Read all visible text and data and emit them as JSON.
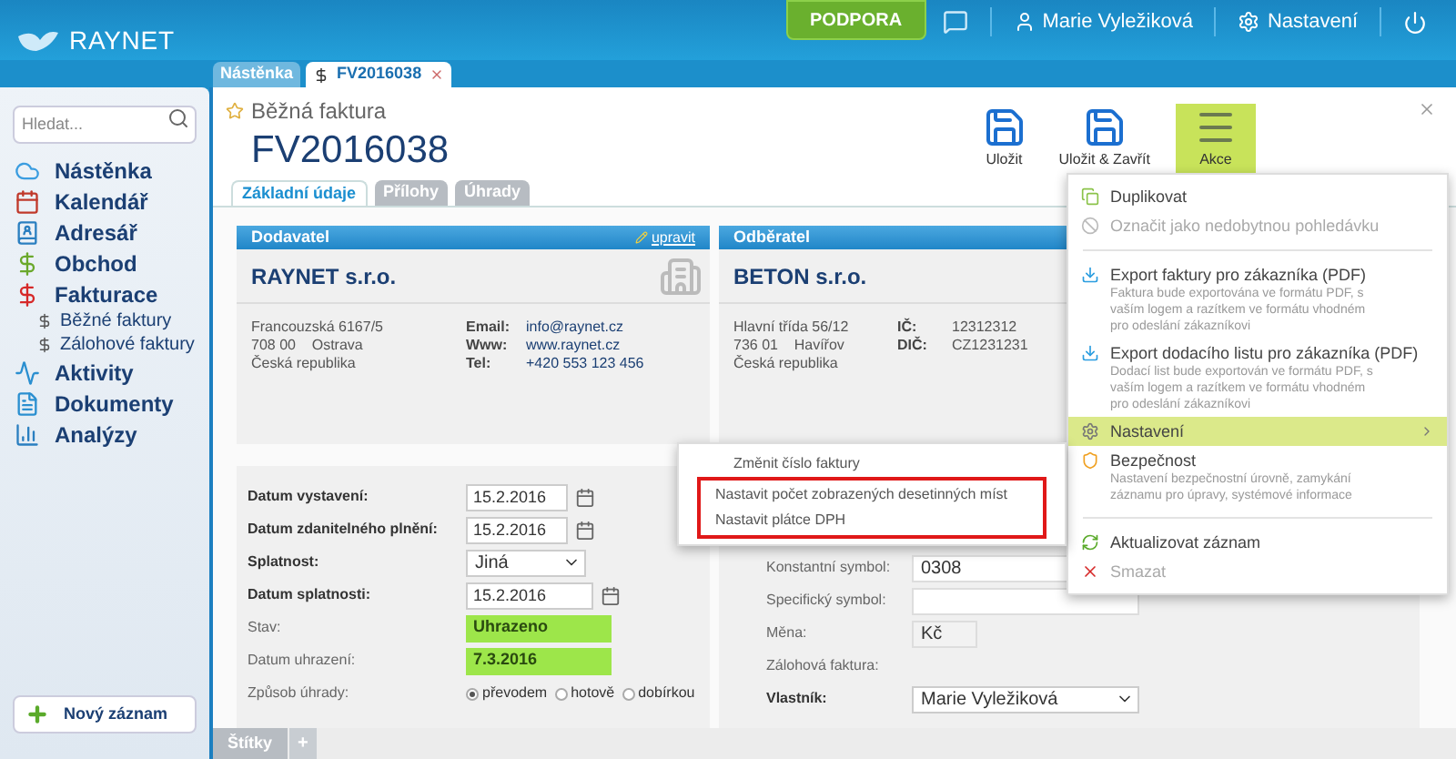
{
  "header": {
    "logo": "RAYNET",
    "support_button": "PODPORA",
    "user": "Marie Vyležiková",
    "settings": "Nastavení"
  },
  "tabs": [
    {
      "label": "Nástěnka",
      "selected": false
    },
    {
      "label": "FV2016038",
      "selected": true
    }
  ],
  "sidebar": {
    "search": {
      "placeholder": "Hledat..."
    },
    "items": [
      {
        "kind": "dashboard",
        "label": "Nástěnka"
      },
      {
        "kind": "calendar",
        "label": "Kalendář"
      },
      {
        "kind": "contacts",
        "label": "Adresář"
      },
      {
        "kind": "deals",
        "label": "Obchod"
      },
      {
        "kind": "invoices",
        "label": "Fakturace",
        "children": [
          {
            "kind": "invoice",
            "label": "Běžné faktury"
          },
          {
            "kind": "invoice",
            "label": "Zálohové faktury"
          }
        ]
      },
      {
        "kind": "activities",
        "label": "Aktivity"
      },
      {
        "kind": "documents",
        "label": "Dokumenty"
      },
      {
        "kind": "analytics",
        "label": "Analýzy"
      }
    ],
    "new_record": "Nový záznam"
  },
  "record": {
    "type": "Běžná faktura",
    "number": "FV2016038"
  },
  "toolbar": [
    {
      "kind": "save",
      "label": "Uložit",
      "selected": false
    },
    {
      "kind": "save_close",
      "label": "Uložit & Zavřít",
      "selected": false
    },
    {
      "kind": "actions",
      "label": "Akce",
      "selected": true
    }
  ],
  "detail_tabs": [
    {
      "label": "Základní údaje",
      "selected": true
    },
    {
      "label": "Přílohy",
      "selected": false
    },
    {
      "label": "Úhrady",
      "selected": false
    }
  ],
  "supplier": {
    "header": "Dodavatel",
    "edit_link": "upravit",
    "name": "RAYNET s.r.o.",
    "address": [
      "Francouzská 6167/5",
      "708 00    Ostrava",
      "Česká republika"
    ],
    "contacts": [
      {
        "label": "Email:",
        "value": "info@raynet.cz"
      },
      {
        "label": "Www:",
        "value": "www.raynet.cz"
      },
      {
        "label": "Tel:",
        "value": "+420 553 123 456"
      }
    ]
  },
  "customer": {
    "header": "Odběratel",
    "name": "BETON s.r.o.",
    "address": [
      "Hlavní třída 56/12",
      "736 01    Havířov",
      "Česká republika"
    ],
    "ids": [
      {
        "label": "IČ:",
        "value": "12312312"
      },
      {
        "label": "DIČ:",
        "value": "CZ1231231"
      }
    ]
  },
  "form_left": [
    {
      "kind": "date",
      "label": "Datum vystavení:",
      "value": "15.2.2016",
      "required": true
    },
    {
      "kind": "date",
      "label": "Datum zdanitelného plnění:",
      "value": "15.2.2016",
      "required": true
    },
    {
      "kind": "select",
      "label": "Splatnost:",
      "value": "Jiná",
      "required": true
    },
    {
      "kind": "date_wide",
      "label": "Datum splatnosti:",
      "value": "15.2.2016",
      "required": true
    },
    {
      "kind": "status",
      "label": "Stav:",
      "value": "Uhrazeno",
      "required": false
    },
    {
      "kind": "status",
      "label": "Datum uhrazení:",
      "value": "7.3.2016",
      "required": false
    },
    {
      "kind": "radio",
      "label": "Způsob úhrady:",
      "required": false,
      "options": [
        {
          "label": "převodem",
          "selected": true
        },
        {
          "label": "hotově",
          "selected": false
        },
        {
          "label": "dobírkou",
          "selected": false
        }
      ]
    }
  ],
  "form_right": [
    {
      "kind": "text",
      "label": "Konstantní symbol:",
      "value": "0308",
      "required": false
    },
    {
      "kind": "text",
      "label": "Specifický symbol:",
      "required": false
    },
    {
      "kind": "short",
      "label": "Měna:",
      "value": "Kč",
      "required": false
    },
    {
      "kind": "none",
      "label": "Zálohová faktura:",
      "required": false
    },
    {
      "kind": "select",
      "label": "Vlastník:",
      "value": "Marie Vyležiková",
      "required": true
    }
  ],
  "actions_menu": [
    {
      "kind": "duplicate",
      "label": "Duplikovat",
      "disabled": false,
      "selected": false
    },
    {
      "kind": "mark",
      "label": "Označit jako nedobytnou pohledávku",
      "disabled": true,
      "selected": false
    },
    {
      "kind": "divider"
    },
    {
      "kind": "export",
      "label": "Export faktury pro zákazníka (PDF)",
      "description": "Faktura bude exportována ve formátu PDF, s vaším logem a razítkem ve formátu vhodném pro odeslání zákazníkovi",
      "disabled": false,
      "selected": false
    },
    {
      "kind": "export",
      "label": "Export dodacího listu pro zákazníka (PDF)",
      "description": "Dodací list bude exportován ve formátu PDF, s vaším logem a razítkem ve formátu vhodném pro odeslání zákazníkovi",
      "disabled": false,
      "selected": false
    },
    {
      "kind": "settings",
      "label": "Nastavení",
      "disabled": false,
      "selected": true
    },
    {
      "kind": "security",
      "label": "Bezpečnost",
      "description": "Nastavení bezpečnostní úrovně, zamykání záznamu pro úpravy, systémové informace",
      "disabled": false,
      "selected": false
    },
    {
      "kind": "divider"
    },
    {
      "kind": "refresh",
      "label": "Aktualizovat záznam",
      "disabled": false,
      "selected": false
    },
    {
      "kind": "delete",
      "label": "Smazat",
      "disabled": true,
      "selected": false
    }
  ],
  "settings_submenu": [
    {
      "label": "Změnit číslo faktury",
      "highlighted": false
    },
    {
      "label": "Nastavit počet zobrazených desetinných míst",
      "highlighted": true
    },
    {
      "label": "Nastavit plátce DPH",
      "highlighted": true
    }
  ],
  "tags_bar": {
    "label": "Štítky",
    "add": "+"
  }
}
